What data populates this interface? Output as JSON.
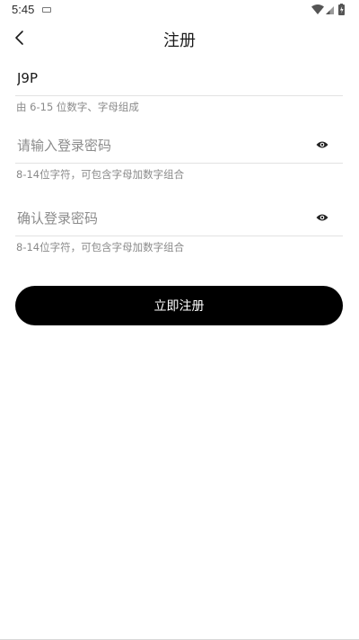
{
  "status_bar": {
    "time": "5:45"
  },
  "header": {
    "title": "注册"
  },
  "form": {
    "username": {
      "value": "J9P",
      "placeholder": "",
      "hint": "由 6-15 位数字、字母组成"
    },
    "password": {
      "value": "",
      "placeholder": "请输入登录密码",
      "hint": "8-14位字符，可包含字母加数字组合"
    },
    "confirm_password": {
      "value": "",
      "placeholder": "确认登录密码",
      "hint": "8-14位字符，可包含字母加数字组合"
    },
    "submit_label": "立即注册"
  },
  "icons": {
    "back": "chevron-left-icon",
    "eye": "eye-icon",
    "wifi": "wifi-icon",
    "signal": "signal-icon",
    "battery": "battery-icon",
    "notification": "keyboard-icon"
  },
  "colors": {
    "button_bg": "#000000",
    "button_text": "#ffffff",
    "hint_text": "#8a8a8a",
    "divider": "#e2e2e2"
  }
}
